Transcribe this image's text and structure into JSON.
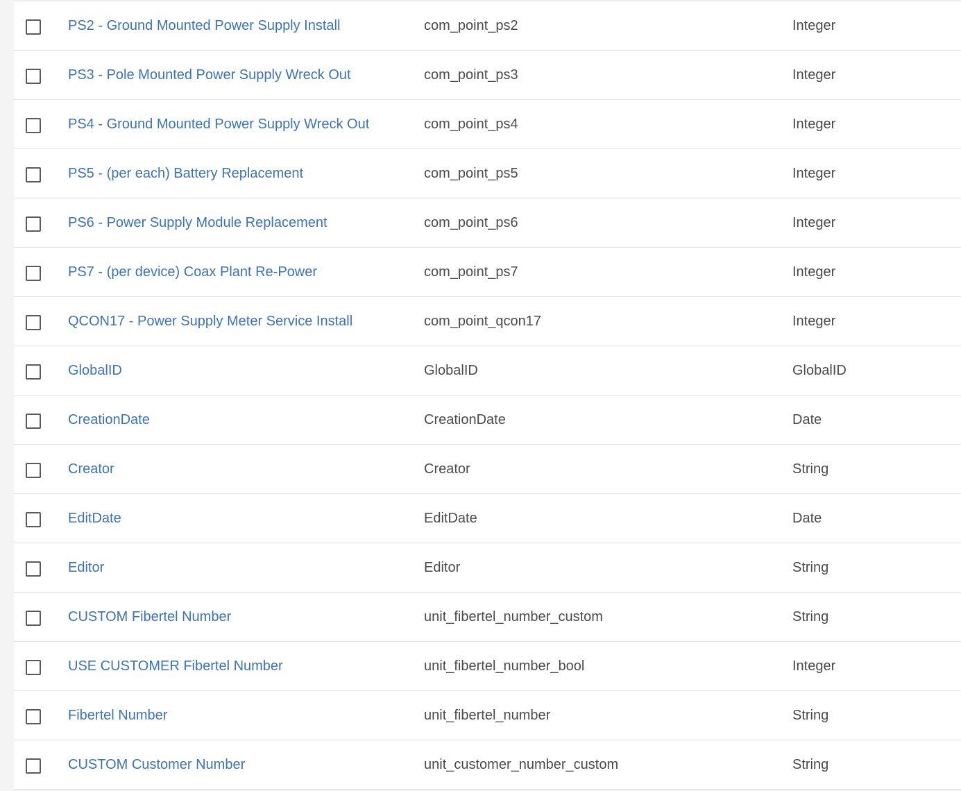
{
  "fields": {
    "rows": [
      {
        "alias": "PS2 - Ground Mounted Power Supply Install",
        "name": "com_point_ps2",
        "type": "Integer"
      },
      {
        "alias": "PS3 - Pole Mounted Power Supply Wreck Out",
        "name": "com_point_ps3",
        "type": "Integer"
      },
      {
        "alias": "PS4 - Ground Mounted Power Supply Wreck Out",
        "name": "com_point_ps4",
        "type": "Integer"
      },
      {
        "alias": "PS5 - (per each) Battery Replacement",
        "name": "com_point_ps5",
        "type": "Integer"
      },
      {
        "alias": "PS6 - Power Supply Module Replacement",
        "name": "com_point_ps6",
        "type": "Integer"
      },
      {
        "alias": "PS7 - (per device) Coax Plant Re-Power",
        "name": "com_point_ps7",
        "type": "Integer"
      },
      {
        "alias": "QCON17 - Power Supply Meter Service Install",
        "name": "com_point_qcon17",
        "type": "Integer"
      },
      {
        "alias": "GlobalID",
        "name": "GlobalID",
        "type": "GlobalID"
      },
      {
        "alias": "CreationDate",
        "name": "CreationDate",
        "type": "Date"
      },
      {
        "alias": "Creator",
        "name": "Creator",
        "type": "String"
      },
      {
        "alias": "EditDate",
        "name": "EditDate",
        "type": "Date"
      },
      {
        "alias": "Editor",
        "name": "Editor",
        "type": "String"
      },
      {
        "alias": "CUSTOM Fibertel Number",
        "name": "unit_fibertel_number_custom",
        "type": "String"
      },
      {
        "alias": "USE CUSTOMER Fibertel Number",
        "name": "unit_fibertel_number_bool",
        "type": "Integer"
      },
      {
        "alias": "Fibertel Number",
        "name": "unit_fibertel_number",
        "type": "String"
      },
      {
        "alias": "CUSTOM Customer Number",
        "name": "unit_customer_number_custom",
        "type": "String"
      }
    ]
  },
  "colors": {
    "link": "#3a73b8",
    "text": "#4a4a4a",
    "divider": "#e2e2e2",
    "background": "#f4f4f4"
  },
  "icons": {
    "row_checkbox": "checkbox-unchecked-icon"
  }
}
